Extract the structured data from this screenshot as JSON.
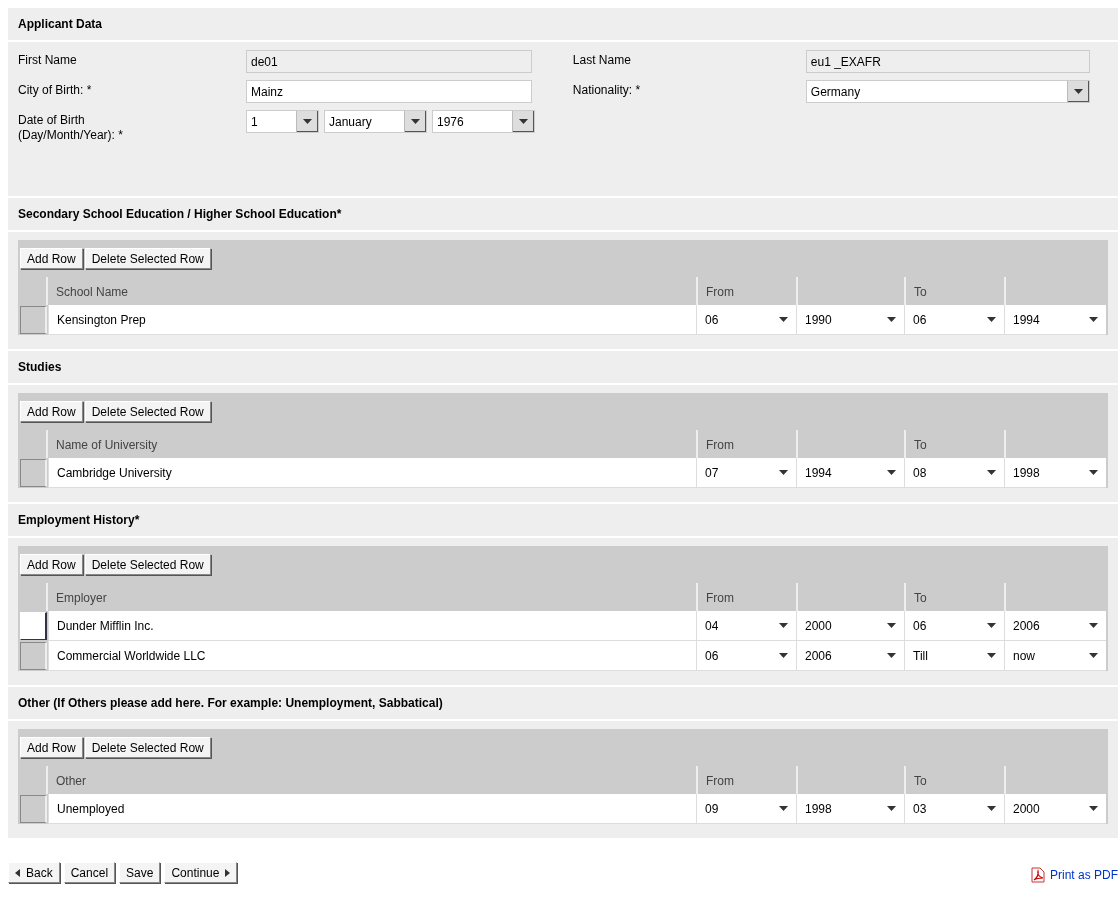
{
  "applicant": {
    "title": "Applicant Data",
    "left_fields": [
      {
        "label": "First Name",
        "kind": "readonly",
        "value": "de01"
      },
      {
        "label": "City of Birth: *",
        "kind": "text",
        "value": "Mainz"
      },
      {
        "label": "Date of Birth (Day/Month/Year): *",
        "kind": "date",
        "parts": [
          "1",
          "January",
          "1976"
        ]
      }
    ],
    "right_fields": [
      {
        "label": "Last Name",
        "kind": "readonly",
        "value": "eu1 _EXAFR"
      },
      {
        "label": "Nationality: *",
        "kind": "select",
        "value": "Germany"
      }
    ]
  },
  "sections": [
    {
      "title": "Secondary School Education / Higher School Education*",
      "buttons": [
        "Add Row",
        "Delete Selected Row"
      ],
      "columns": [
        "School Name",
        "From",
        "",
        "To",
        ""
      ],
      "rows": [
        {
          "selected": false,
          "cells": [
            "Kensington Prep",
            "06",
            "1990",
            "06",
            "1994"
          ]
        }
      ]
    },
    {
      "title": "Studies",
      "buttons": [
        "Add Row",
        "Delete Selected Row"
      ],
      "columns": [
        "Name of University",
        "From",
        "",
        "To",
        ""
      ],
      "rows": [
        {
          "selected": false,
          "cells": [
            "Cambridge University",
            "07",
            "1994",
            "08",
            "1998"
          ]
        }
      ]
    },
    {
      "title": "Employment History*",
      "buttons": [
        "Add Row",
        "Delete Selected Row"
      ],
      "columns": [
        "Employer",
        "From",
        "",
        "To",
        ""
      ],
      "rows": [
        {
          "selected": true,
          "cells": [
            "Dunder Mifflin Inc.",
            "04",
            "2000",
            "06",
            "2006"
          ]
        },
        {
          "selected": false,
          "cells": [
            "Commercial Worldwide LLC",
            "06",
            "2006",
            "Till",
            "now"
          ]
        }
      ]
    },
    {
      "title": "Other (If Others please add here. For example: Unemployment, Sabbatical)",
      "buttons": [
        "Add Row",
        "Delete Selected Row"
      ],
      "columns": [
        "Other",
        "From",
        "",
        "To",
        ""
      ],
      "rows": [
        {
          "selected": false,
          "cells": [
            "Unemployed",
            "09",
            "1998",
            "03",
            "2000"
          ]
        }
      ]
    }
  ],
  "footer": {
    "buttons": [
      {
        "label": "Back",
        "kind": "back"
      },
      {
        "label": "Cancel",
        "kind": "plain"
      },
      {
        "label": "Save",
        "kind": "plain"
      },
      {
        "label": "Continue",
        "kind": "forward"
      }
    ],
    "link": "Print as PDF"
  }
}
